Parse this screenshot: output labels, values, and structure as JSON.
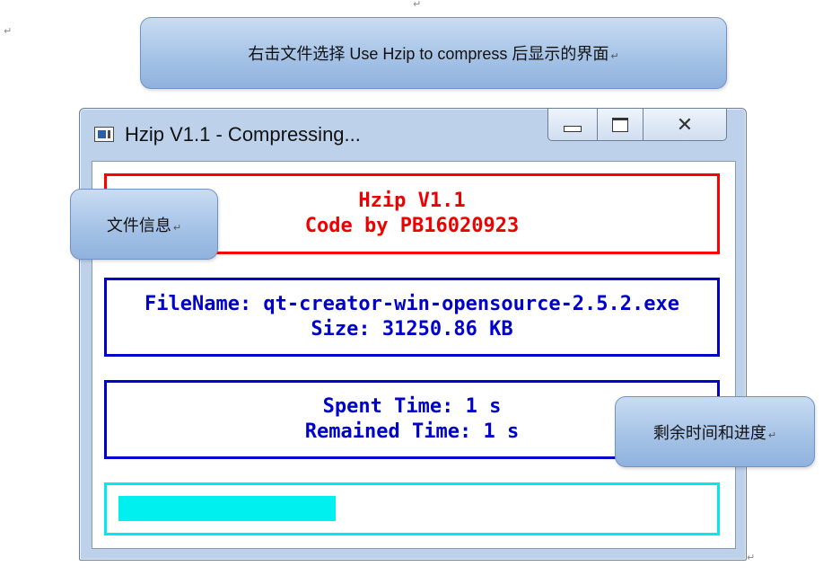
{
  "doc": {
    "para_mark": "↵"
  },
  "callouts": {
    "top": "右击文件选择 Use Hzip to compress  后显示的界面",
    "file_info": "文件信息",
    "time_progress": "剩余时间和进度"
  },
  "window": {
    "title": "Hzip V1.1 - Compressing...",
    "controls": {
      "minimize_icon": "minimize-icon",
      "maximize_icon": "maximize-icon",
      "close_icon": "close-icon",
      "close_glyph": "✕"
    }
  },
  "header_panel": {
    "line1": "Hzip V1.1",
    "line2": "Code by PB16020923"
  },
  "file_panel": {
    "name_line": "FileName: qt-creator-win-opensource-2.5.2.exe",
    "size_line": "Size: 31250.86 KB"
  },
  "time_panel": {
    "spent_line": "Spent Time: 1 s",
    "remained_line": "Remained Time: 1 s"
  },
  "progress": {
    "fraction": 0.37
  },
  "colors": {
    "header_border": "#ff0000",
    "header_text": "#ee0000",
    "info_border": "#0000cc",
    "progress_border": "#00e8f0",
    "progress_fill": "#00f0f0",
    "callout_fill": "#a6c3e6"
  }
}
